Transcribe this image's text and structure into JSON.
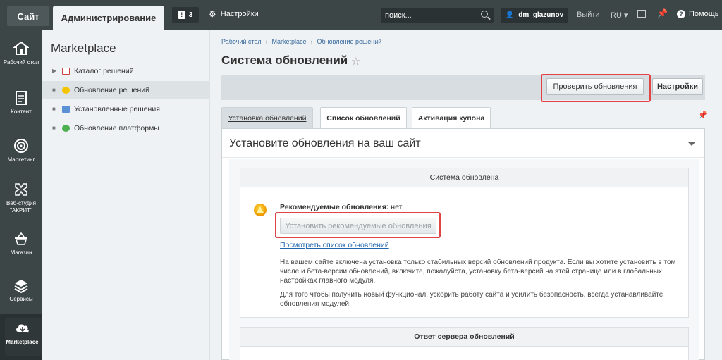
{
  "topbar": {
    "site_label": "Сайт",
    "admin_label": "Администрирование",
    "notifications_count": "3",
    "settings_label": "Настройки",
    "search_placeholder": "поиск...",
    "user_name": "dm_glazunov",
    "exit_label": "Выйти",
    "lang_label": "RU",
    "help_label": "Помощь"
  },
  "leftnav": {
    "items": [
      {
        "label": "Рабочий стол",
        "icon": "home-icon"
      },
      {
        "label": "Контент",
        "icon": "document-icon"
      },
      {
        "label": "Маркетинг",
        "icon": "target-icon"
      },
      {
        "label": "Веб-студия \"АКРИТ\"",
        "icon": "studio-logo-icon"
      },
      {
        "label": "Магазин",
        "icon": "basket-icon"
      },
      {
        "label": "Сервисы",
        "icon": "layers-icon"
      },
      {
        "label": "Marketplace",
        "icon": "cloud-download-icon"
      }
    ]
  },
  "subnav": {
    "title": "Marketplace",
    "items": [
      {
        "label": "Каталог решений",
        "icon": "catalog-icon"
      },
      {
        "label": "Обновление решений",
        "icon": "update-icon"
      },
      {
        "label": "Установленные решения",
        "icon": "installed-icon"
      },
      {
        "label": "Обновление платформы",
        "icon": "platform-icon"
      }
    ]
  },
  "breadcrumb": [
    "Рабочий стол",
    "Marketplace",
    "Обновление решений"
  ],
  "page": {
    "title": "Система обновлений",
    "check_button": "Проверить обновления",
    "settings_button": "Настройки",
    "tabs": [
      "Установка обновлений",
      "Список обновлений",
      "Активация купона"
    ],
    "panel_heading": "Установите обновления на ваш сайт",
    "status_header": "Система обновлена",
    "recommended_label": "Рекомендуемые обновления:",
    "recommended_value": "нет",
    "install_button": "Установить рекомендуемые обновления",
    "view_list_link": "Посмотреть список обновлений",
    "para1": "На вашем сайте включена установка только стабильных версий обновлений продукта. Если вы хотите установить в том числе и бета-версии обновлений, включите, пожалуйста, установку бета-версий на этой странице или в глобальных настройках главного модуля.",
    "para2": "Для того чтобы получить новый функционал, ускорить работу сайта и усилить безопасность, всегда устанавливайте обновления модулей.",
    "server_response_header": "Ответ сервера обновлений"
  }
}
